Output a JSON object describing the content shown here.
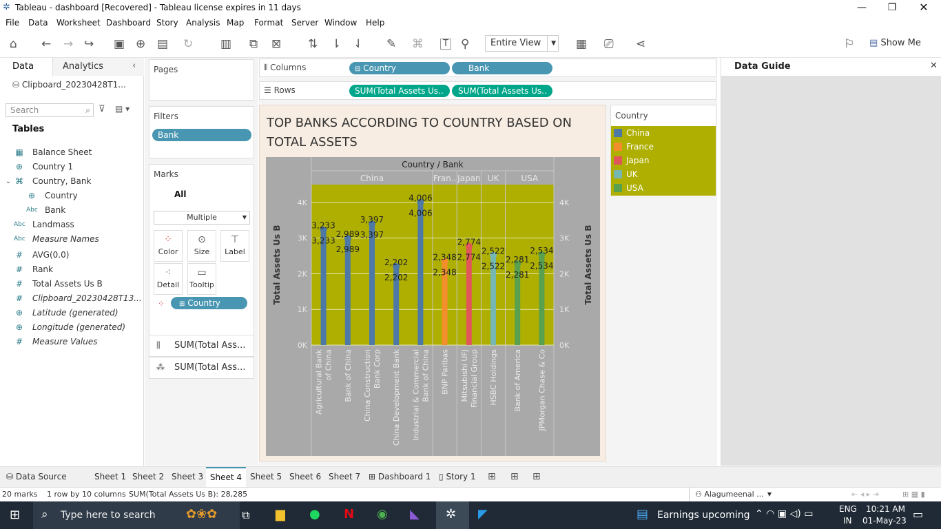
{
  "window": {
    "title": "Tableau - dashboard [Recovered] - Tableau license expires in 11 days"
  },
  "menu": [
    "File",
    "Data",
    "Worksheet",
    "Dashboard",
    "Story",
    "Analysis",
    "Map",
    "Format",
    "Server",
    "Window",
    "Help"
  ],
  "toolbar": {
    "fit": "Entire View",
    "show_me": "Show Me"
  },
  "left": {
    "tab_data": "Data",
    "tab_analytics": "Analytics",
    "datasource": "Clipboard_20230428T1...",
    "search_placeholder": "Search",
    "tables_header": "Tables",
    "fields": [
      {
        "label": "Balance Sheet",
        "type": "table"
      },
      {
        "label": "Country 1",
        "type": "geo"
      },
      {
        "label": "Country, Bank",
        "type": "hier"
      },
      {
        "label": "Country",
        "type": "geo"
      },
      {
        "label": "Bank",
        "type": "abc"
      },
      {
        "label": "Landmass",
        "type": "abc"
      },
      {
        "label": "Measure Names",
        "type": "abc"
      },
      {
        "label": "AVG(0.0)",
        "type": "num"
      },
      {
        "label": "Rank",
        "type": "num"
      },
      {
        "label": "Total Assets Us B",
        "type": "num"
      },
      {
        "label": "Clipboard_20230428T13...",
        "type": "num"
      },
      {
        "label": "Latitude (generated)",
        "type": "geo"
      },
      {
        "label": "Longitude (generated)",
        "type": "geo"
      },
      {
        "label": "Measure Values",
        "type": "num"
      }
    ]
  },
  "cards": {
    "pages": "Pages",
    "filters": "Filters",
    "filter_pill": "Bank",
    "marks": "Marks",
    "marks_all": "All",
    "mark_type": "Multiple",
    "buttons": [
      "Color",
      "Size",
      "Label",
      "Detail",
      "Tooltip"
    ],
    "color_pill": "Country",
    "measure1": "SUM(Total Ass...",
    "measure2": "SUM(Total Ass..."
  },
  "shelves": {
    "columns_label": "Columns",
    "rows_label": "Rows",
    "columns": [
      "Country",
      "Bank"
    ],
    "rows": [
      "SUM(Total Assets Us..",
      "SUM(Total Assets Us.."
    ]
  },
  "legend": {
    "title": "Country",
    "items": [
      {
        "label": "China",
        "color": "#4e79a7"
      },
      {
        "label": "France",
        "color": "#f28e2b"
      },
      {
        "label": "Japan",
        "color": "#e15759"
      },
      {
        "label": "UK",
        "color": "#76b7b2"
      },
      {
        "label": "USA",
        "color": "#59a14f"
      }
    ]
  },
  "data_guide": {
    "title": "Data Guide"
  },
  "chart_data": {
    "type": "bar",
    "title": "TOP BANKS ACCORDING TO COUNTRY BASED ON TOTAL ASSETS",
    "header": "Country / Bank",
    "ylabel": "Total Assets Us B",
    "y2label": "Total Assets Us B",
    "ylim": [
      0,
      4500
    ],
    "yticks": [
      "0K",
      "1K",
      "2K",
      "3K",
      "4K"
    ],
    "plot_bg": "#aeaf00",
    "country_groups": [
      {
        "label": "China",
        "count": 5
      },
      {
        "label": "Fran..",
        "count": 1
      },
      {
        "label": "Japan",
        "count": 1
      },
      {
        "label": "UK",
        "count": 1
      },
      {
        "label": "USA",
        "count": 2
      }
    ],
    "categories": [
      "Agricultural Bank of China",
      "Bank of China",
      "China Construction Bank Corp",
      "China Development Bank",
      "Industrial & Commercial Bank of China",
      "BNP Paribas",
      "Mitsubishi UFJ Financial Group",
      "HSBC Holdings",
      "Bank of America",
      "JPMorgan Chase & Co"
    ],
    "countries": [
      "China",
      "China",
      "China",
      "China",
      "China",
      "France",
      "Japan",
      "UK",
      "USA",
      "USA"
    ],
    "values": [
      3233,
      2989,
      3397,
      2202,
      4006,
      2348,
      2774,
      2522,
      2281,
      2534
    ],
    "value_labels": [
      "3,233",
      "2,989",
      "3,397",
      "2,202",
      "4,006",
      "2,348",
      "2,774",
      "2,522",
      "2,281",
      "2,534"
    ]
  },
  "sheets": {
    "data_source": "Data Source",
    "tabs": [
      "Sheet 1",
      "Sheet 2",
      "Sheet 3",
      "Sheet 4",
      "Sheet 5",
      "Sheet 6",
      "Sheet 7",
      "Dashboard 1",
      "Story 1"
    ],
    "active": "Sheet 4"
  },
  "status": {
    "marks": "20 marks",
    "rows": "1 row by 10 columns",
    "sum": "SUM(Total Assets Us B): 28,285",
    "user": "Alagumeenal ..."
  },
  "taskbar": {
    "search_placeholder": "Type here to search",
    "news": "Earnings upcoming",
    "lang1": "ENG",
    "lang2": "IN",
    "time": "10:21 AM",
    "date": "01-May-23"
  }
}
